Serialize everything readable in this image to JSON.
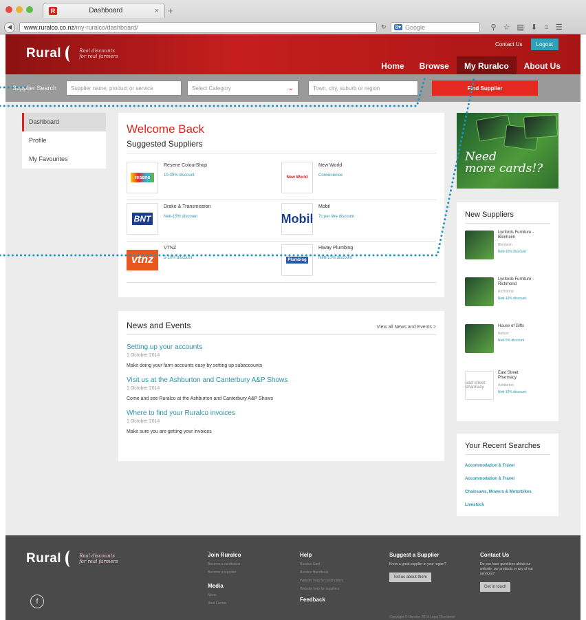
{
  "browser": {
    "tab_title": "Dashboard",
    "tab_favicon": "R",
    "url_host": "www.ruralco.co.nz",
    "url_path": "/my-ruralco/dashboard/",
    "search_engine": "Google"
  },
  "header": {
    "logo": "Rural",
    "logo_tagline_1": "Real discounts",
    "logo_tagline_2": "for real farmers",
    "contact_us": "Contact Us",
    "logout": "Logout",
    "nav": [
      "Home",
      "Browse",
      "My Ruralco",
      "About Us"
    ],
    "active_nav": "My Ruralco"
  },
  "search": {
    "label": "Supplier Search",
    "name_placeholder": "Supplier name, product or service",
    "category_placeholder": "Select Category",
    "location_placeholder": "Town, city, suburb or region",
    "find_button": "Find Supplier"
  },
  "sidebar": {
    "items": [
      "Dashboard",
      "Profile",
      "My Favourites"
    ],
    "active": "Dashboard"
  },
  "welcome": {
    "title": "Welcome Back",
    "subtitle": "Suggested Suppliers",
    "suppliers": [
      {
        "name": "Resene ColourShop",
        "discount": "10-30% discount",
        "logo": "resene"
      },
      {
        "name": "New World",
        "discount": "Convenience",
        "logo": "New World"
      },
      {
        "name": "Drake & Transmission",
        "discount": "Nett-15% discount",
        "logo": "BNT"
      },
      {
        "name": "Mobil",
        "discount": "7c per litre discount",
        "logo": "Mobil"
      },
      {
        "name": "VTNZ",
        "discount": "5-10% discount",
        "logo": "vtnz"
      },
      {
        "name": "Hiway Plumbing",
        "discount": "Nett-10% discount",
        "logo": "Plumbing"
      }
    ]
  },
  "news": {
    "title": "News and Events",
    "view_all": "View all News and Events >",
    "items": [
      {
        "title": "Setting up your accounts",
        "date": "1 October 2014",
        "desc": "Make doing your farm accounts easy by setting up subaccounts"
      },
      {
        "title": "Visit us at the Ashburton and Canterbury A&P Shows",
        "date": "1 October 2014",
        "desc": "Come and see Ruralco at the Ashburton and Canterbury A&P Shows"
      },
      {
        "title": "Where to find your Ruralco invoices",
        "date": "1 October 2014",
        "desc": "Make sure you are getting your invoices"
      }
    ]
  },
  "promo": {
    "line1": "Need",
    "line2": "more cards!?"
  },
  "new_suppliers": {
    "title": "New Suppliers",
    "items": [
      {
        "name": "Lynfords Furniture - Blenheim",
        "location": "Blenheim",
        "discount": "Nett-10% discount",
        "thumb": "card"
      },
      {
        "name": "Lynfords Furniture - Richmond",
        "location": "Richmond",
        "discount": "Nett-10% discount",
        "thumb": "card"
      },
      {
        "name": "House of Gifts",
        "location": "Nelson",
        "discount": "Nett-5% discount",
        "thumb": "card"
      },
      {
        "name": "East Street Pharmacy",
        "location": "Ashburton",
        "discount": "Nett-10% discount",
        "thumb": "east street pharmacy"
      }
    ]
  },
  "recent_searches": {
    "title": "Your Recent Searches",
    "items": [
      "Accommodation & Travel",
      "Accommodation & Travel",
      "Chainsaws, Mowers & Motorbikes",
      "Livestock"
    ]
  },
  "footer": {
    "join_title": "Join Ruralco",
    "join_links": [
      "Become a cardholder",
      "Become a supplier"
    ],
    "media_title": "Media",
    "media_links": [
      "News",
      "Real Farmer"
    ],
    "help_title": "Help",
    "help_links": [
      "Ruralco Card",
      "Ruralco Handbook",
      "Website help for cardholders",
      "Website help for suppliers"
    ],
    "feedback_title": "Feedback",
    "suggest_title": "Suggest a Supplier",
    "suggest_text": "Know a great supplier in your region?",
    "suggest_button": "Tell us about them",
    "contact_title": "Contact Us",
    "contact_text": "Do you have questions about our website, our products or any of our services?",
    "contact_button": "Get in touch",
    "copyright": "Copyright © Ruralco 2014    Legal Disclaimer",
    "social": "f"
  }
}
